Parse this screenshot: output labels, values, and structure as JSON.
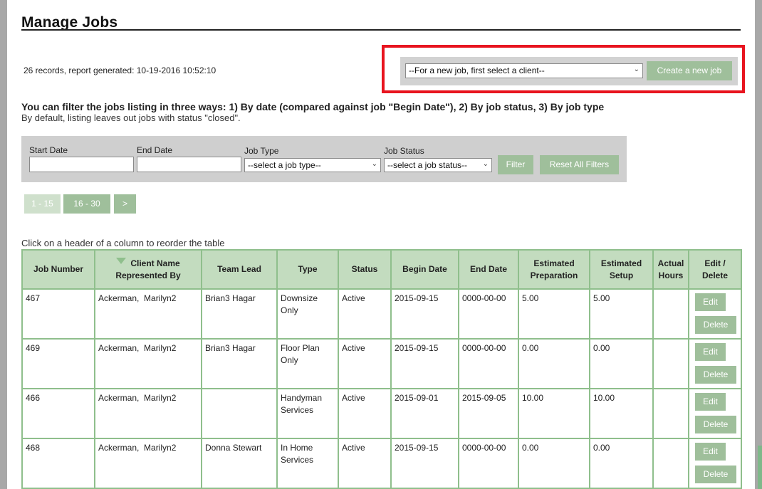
{
  "page": {
    "title": "Manage Jobs",
    "records_text": "26 records, report generated: 10-19-2016 10:52:10"
  },
  "new_job": {
    "client_select_value": "--For a new job, first select a client--",
    "create_button": "Create a new job"
  },
  "filter_info": {
    "headline": "You can filter the jobs listing in three ways: 1) By date (compared against job \"Begin Date\"), 2) By job status, 3) By job type",
    "subline": "By default, listing leaves out jobs with status \"closed\"."
  },
  "filters": {
    "start_date_label": "Start Date",
    "start_date_value": "",
    "end_date_label": "End Date",
    "end_date_value": "",
    "job_type_label": "Job Type",
    "job_type_value": "--select a job type--",
    "job_status_label": "Job Status",
    "job_status_value": "--select a job status--",
    "filter_button": "Filter",
    "reset_button": "Reset All Filters"
  },
  "pager": {
    "pages": [
      "1 - 15",
      "16 - 30"
    ],
    "next": ">",
    "current_index": 0
  },
  "table": {
    "note": "Click on a header of a column to reorder the table",
    "headers": {
      "job_number": "Job Number",
      "client_name_line1": "Client Name",
      "client_name_line2": "Represented By",
      "team_lead": "Team Lead",
      "type": "Type",
      "status": "Status",
      "begin_date": "Begin Date",
      "end_date": "End Date",
      "est_prep_line1": "Estimated",
      "est_prep_line2": "Preparation",
      "est_setup_line1": "Estimated",
      "est_setup_line2": "Setup",
      "actual_hours_line1": "Actual",
      "actual_hours_line2": "Hours",
      "edit_delete_line1": "Edit /",
      "edit_delete_line2": "Delete"
    },
    "sorted_column": "client_name",
    "edit_label": "Edit",
    "delete_label": "Delete",
    "rows": [
      {
        "job_number": "467",
        "client": "Ackerman,  Marilyn2",
        "team_lead": "Brian3 Hagar",
        "type_line1": "Downsize",
        "type_line2": "Only",
        "status": "Active",
        "begin_date": "2015-09-15",
        "end_date": "0000-00-00",
        "est_prep": "5.00",
        "est_setup": "5.00",
        "actual_hours": ""
      },
      {
        "job_number": "469",
        "client": "Ackerman,  Marilyn2",
        "team_lead": "Brian3 Hagar",
        "type_line1": "Floor Plan",
        "type_line2": "Only",
        "status": "Active",
        "begin_date": "2015-09-15",
        "end_date": "0000-00-00",
        "est_prep": "0.00",
        "est_setup": "0.00",
        "actual_hours": ""
      },
      {
        "job_number": "466",
        "client": "Ackerman,  Marilyn2",
        "team_lead": "",
        "type_line1": "Handyman",
        "type_line2": "Services",
        "status": "Active",
        "begin_date": "2015-09-01",
        "end_date": "2015-09-05",
        "est_prep": "10.00",
        "est_setup": "10.00",
        "actual_hours": ""
      },
      {
        "job_number": "468",
        "client": "Ackerman,  Marilyn2",
        "team_lead": "Donna Stewart",
        "type_line1": "In Home",
        "type_line2": "Services",
        "status": "Active",
        "begin_date": "2015-09-15",
        "end_date": "0000-00-00",
        "est_prep": "0.00",
        "est_setup": "0.00",
        "actual_hours": ""
      }
    ]
  },
  "colors": {
    "button_green": "#9fbf9b",
    "header_green": "#c3dcbf",
    "border_green": "#8fbf8c",
    "highlight_red": "#e8141f",
    "panel_gray": "#cfcfcf"
  }
}
